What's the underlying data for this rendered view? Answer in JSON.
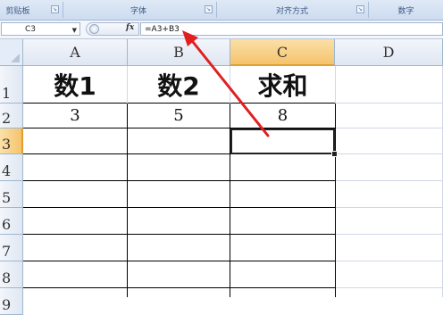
{
  "ribbon": {
    "groups": [
      {
        "label": "剪贴板"
      },
      {
        "label": "字体"
      },
      {
        "label": "对齐方式"
      },
      {
        "label": "数字"
      }
    ]
  },
  "formula_bar": {
    "name_box": "C3",
    "fx_label": "fx",
    "formula": "=A3+B3"
  },
  "columns": [
    "A",
    "B",
    "C",
    "D"
  ],
  "rows": [
    "1",
    "2",
    "3",
    "4",
    "5",
    "6",
    "7",
    "8",
    "9"
  ],
  "cells": {
    "A1": "数1",
    "B1": "数2",
    "C1": "求和",
    "A2": "3",
    "B2": "5",
    "C2": "8"
  },
  "selection": {
    "active_cell": "C3"
  },
  "colors": {
    "annotation_arrow": "#e02020",
    "active_header": "#f5c46c"
  }
}
